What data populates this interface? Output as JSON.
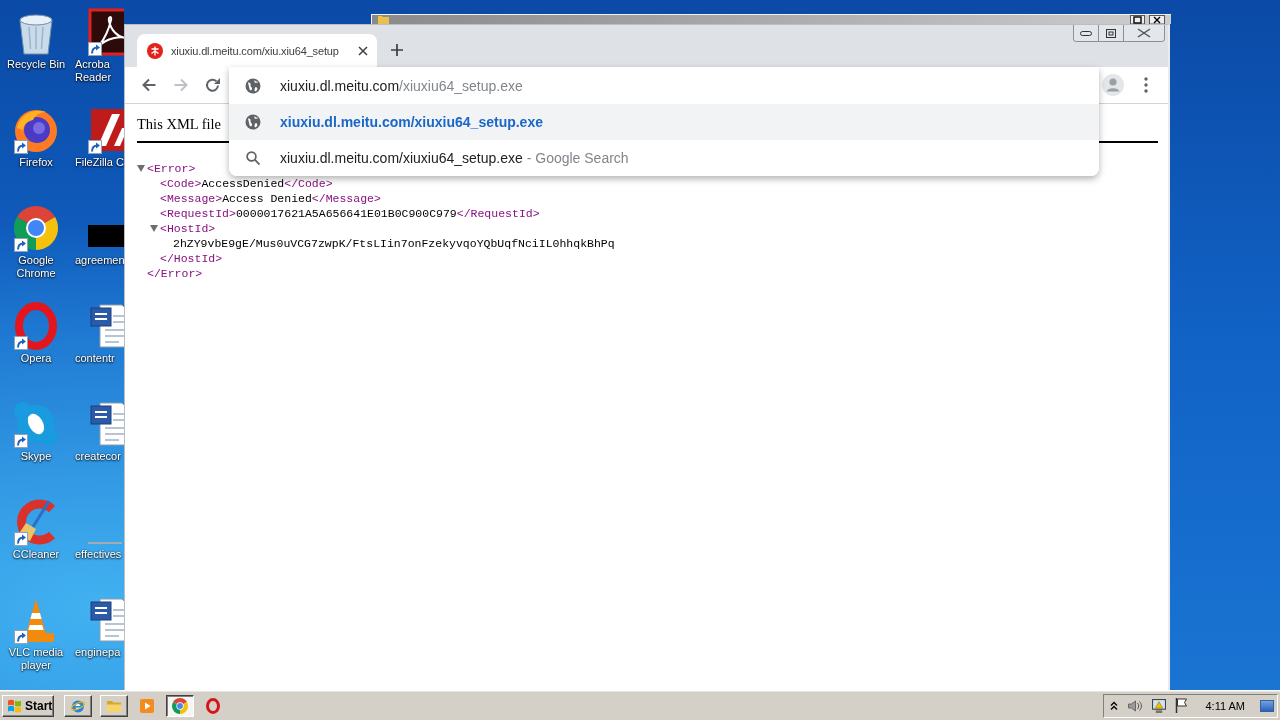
{
  "desktop": {
    "icons": [
      {
        "kind": "recycle-bin",
        "shortcut": false,
        "lines": [
          "Recycle Bin"
        ]
      },
      {
        "kind": "firefox",
        "shortcut": true,
        "lines": [
          "Firefox"
        ]
      },
      {
        "kind": "chrome",
        "shortcut": true,
        "lines": [
          "Google",
          "Chrome"
        ]
      },
      {
        "kind": "opera",
        "shortcut": true,
        "lines": [
          "Opera"
        ]
      },
      {
        "kind": "skype",
        "shortcut": true,
        "lines": [
          "Skype"
        ]
      },
      {
        "kind": "ccleaner",
        "shortcut": true,
        "lines": [
          "CCleaner"
        ]
      },
      {
        "kind": "vlc",
        "shortcut": true,
        "lines": [
          "VLC media",
          "player"
        ]
      }
    ],
    "icons_column_2": [
      {
        "kind": "acrobat",
        "shortcut": true,
        "lines": [
          "Acroba",
          "Reader"
        ]
      },
      {
        "kind": "filezilla",
        "shortcut": true,
        "lines": [
          "FileZilla C"
        ]
      },
      {
        "kind": "dark-image",
        "shortcut": false,
        "lines": [
          "agreemen"
        ]
      },
      {
        "kind": "word",
        "shortcut": false,
        "lines": [
          "contentr"
        ]
      },
      {
        "kind": "word",
        "shortcut": false,
        "lines": [
          "createcor"
        ]
      },
      {
        "kind": "light-image",
        "shortcut": false,
        "lines": [
          "effectives"
        ]
      },
      {
        "kind": "word",
        "shortcut": false,
        "lines": [
          "enginepa"
        ]
      }
    ]
  },
  "browser": {
    "tabs": [
      {
        "title": "xiuxiu.dl.meitu.com/xiu.xiu64_setup",
        "selected": true
      }
    ],
    "nav_buttons": [
      {
        "kind": "back",
        "disabled": false
      },
      {
        "kind": "forward",
        "disabled": true
      },
      {
        "kind": "reload",
        "disabled": false
      }
    ],
    "omnibox": {
      "text": "xiuxiu.dl.meitu.com",
      "completion": "/xiuxiu64_setup.exe",
      "suggestions": [
        {
          "kind": "url",
          "text": "xiuxiu.dl.meitu.com/xiuxiu64_setup.exe",
          "selected": true
        },
        {
          "kind": "search",
          "text": "xiuxiu.dl.meitu.com/xiuxiu64_setup.exe",
          "suffix": " - Google Search",
          "selected": false
        }
      ]
    },
    "page": {
      "notice": "This XML file",
      "xml_tree": [
        {
          "kind": "element",
          "open": "<Error>",
          "close": "</Error>",
          "expanded": true,
          "children": [
            {
              "kind": "leaf",
              "open": "<Code>",
              "text": "AccessDenied",
              "close": "</Code>"
            },
            {
              "kind": "leaf",
              "open": "<Message>",
              "text": "Access Denied",
              "close": "</Message>"
            },
            {
              "kind": "leaf",
              "open": "<RequestId>",
              "text": "0000017621A5A656641E01B0C900C979",
              "close": "</RequestId>"
            },
            {
              "kind": "element",
              "open": "<HostId>",
              "close": "</HostId>",
              "expanded": true,
              "children": [
                {
                  "kind": "text",
                  "text": "2hZY9vbE9gE/Mus0uVCG7zwpK/FtsLIin7onFzekyvqoYQbUqfNciIL0hhqkBhPq"
                }
              ]
            }
          ]
        }
      ]
    }
  },
  "taskbar": {
    "start_label": "Start",
    "items": [
      {
        "kind": "ie",
        "open": true,
        "selected": false
      },
      {
        "kind": "folder",
        "open": true,
        "selected": false
      },
      {
        "kind": "media",
        "open": false,
        "selected": false
      },
      {
        "kind": "chrome",
        "open": true,
        "selected": true
      },
      {
        "kind": "opera",
        "open": false,
        "selected": false
      }
    ],
    "clock": "4:11 AM"
  }
}
